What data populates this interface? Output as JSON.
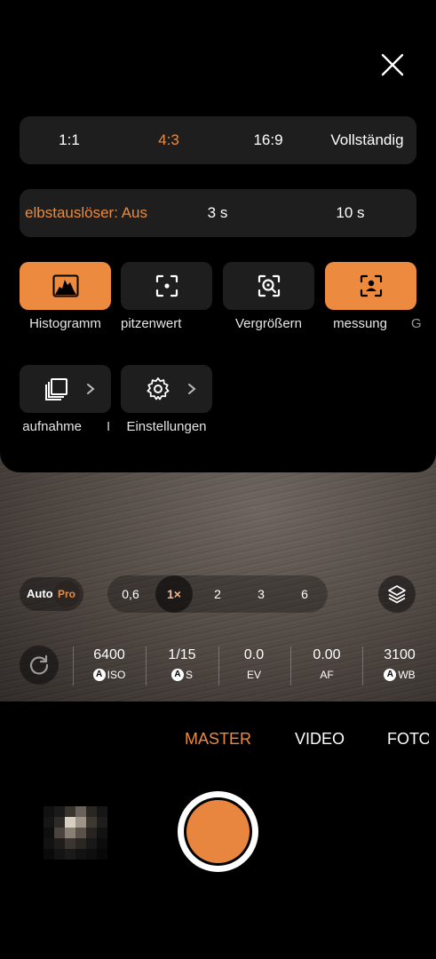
{
  "settings_sheet": {
    "aspect_ratios": [
      {
        "label": "1:1",
        "active": false
      },
      {
        "label": "4:3",
        "active": true
      },
      {
        "label": "16:9",
        "active": false
      },
      {
        "label": "Vollständig",
        "active": false
      }
    ],
    "timer": [
      {
        "label": "elbstauslöser: Aus",
        "active": true
      },
      {
        "label": "3 s",
        "active": false
      },
      {
        "label": "10 s",
        "active": false
      }
    ],
    "toggles": [
      {
        "label": "Histogramm",
        "icon": "histogram-icon",
        "on": true
      },
      {
        "label": "pitzenwert",
        "icon": "focus-peaking-icon",
        "on": false
      },
      {
        "label": "Vergrößern",
        "icon": "magnify-icon",
        "on": false
      },
      {
        "label": "messung",
        "icon": "portrait-metering-icon",
        "on": true
      },
      {
        "label": "G",
        "icon": "",
        "on": false
      }
    ],
    "links": [
      {
        "label": "aufnahme",
        "icon": "burst-icon"
      },
      {
        "label": "I",
        "icon": ""
      },
      {
        "label": "Einstellungen",
        "icon": "gear-icon"
      }
    ]
  },
  "zoom": {
    "mode_auto": "Auto",
    "mode_pro": "Pro",
    "levels": [
      {
        "label": "0,6",
        "active": false
      },
      {
        "label": "1×",
        "active": true
      },
      {
        "label": "2",
        "active": false
      },
      {
        "label": "3",
        "active": false
      },
      {
        "label": "6",
        "active": false
      }
    ]
  },
  "pro_params": [
    {
      "value": "6400",
      "label": "ISO",
      "auto": true
    },
    {
      "value": "1/15",
      "label": "S",
      "auto": true
    },
    {
      "value": "0.0",
      "label": "EV",
      "auto": false
    },
    {
      "value": "0.00",
      "label": "AF",
      "auto": false
    },
    {
      "value": "3100",
      "label": "WB",
      "auto": true
    }
  ],
  "camera_modes": [
    {
      "label": "MASTER",
      "active": true
    },
    {
      "label": "VIDEO",
      "active": false
    },
    {
      "label": "FOTO",
      "active": false
    }
  ],
  "colors": {
    "accent": "#ec8a3f",
    "panel": "#1e1e1e"
  }
}
